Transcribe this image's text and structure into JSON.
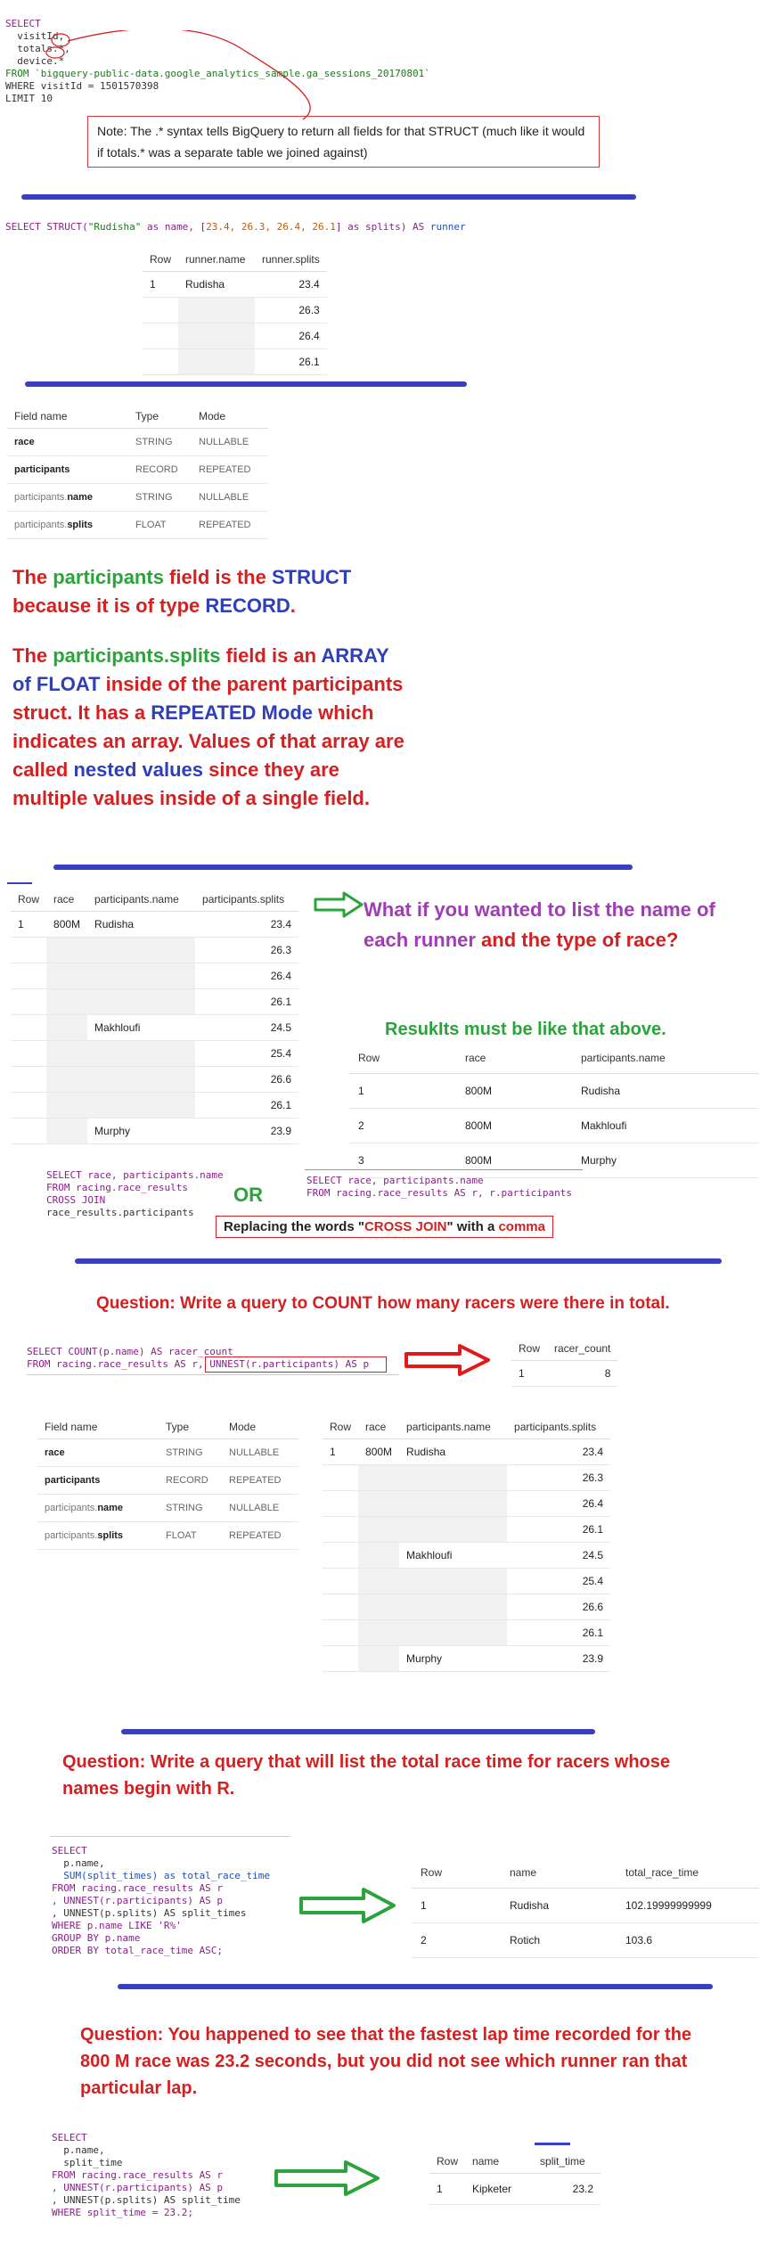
{
  "colors": {
    "red": "#d42020",
    "green": "#2aa43a",
    "blue": "#2e3fb8",
    "purple": "#a03cb4",
    "divider": "#3a3fc0"
  },
  "q1": {
    "lines": [
      "SELECT",
      "  visitId,",
      "  totals.*,",
      "  device.*",
      "FROM `bigquery-public-data.google_analytics_sample.ga_sessions_20170801`",
      "WHERE visitId = 1501570398",
      "LIMIT 10"
    ],
    "note": "Note: The .* syntax tells BigQuery to return all fields for that STRUCT (much like it would if totals.* was a separate table we joined against)"
  },
  "q2": {
    "sql": "SELECT STRUCT(\"Rudisha\" as name, [23.4, 26.3, 26.4, 26.1] as splits) AS runner",
    "table": {
      "headers": [
        "Row",
        "runner.name",
        "runner.splits"
      ],
      "row": "1",
      "name": "Rudisha",
      "splits": [
        "23.4",
        "26.3",
        "26.4",
        "26.1"
      ]
    }
  },
  "schema": {
    "headers": [
      "Field name",
      "Type",
      "Mode"
    ],
    "rows": [
      {
        "prefix": "",
        "name": "race",
        "type": "STRING",
        "mode": "NULLABLE"
      },
      {
        "prefix": "",
        "name": "participants",
        "type": "RECORD",
        "mode": "REPEATED"
      },
      {
        "prefix": "participants.",
        "name": "name",
        "type": "STRING",
        "mode": "NULLABLE"
      },
      {
        "prefix": "participants.",
        "name": "splits",
        "type": "FLOAT",
        "mode": "REPEATED"
      }
    ]
  },
  "explain": {
    "p1": [
      "The ",
      "participants",
      " field is the ",
      "STRUCT",
      " because it is of type ",
      "RECORD",
      "."
    ],
    "p2": [
      "The ",
      "participants.splits",
      " field is an ",
      "ARRAY of FLOAT",
      " inside of the parent participants struct. It has a ",
      "REPEATED Mode",
      " which indicates an array. Values of that array are called ",
      "nested values",
      " since they are multiple values inside of a single field."
    ]
  },
  "race_table": {
    "headers": [
      "Row",
      "race",
      "participants.name",
      "participants.splits"
    ],
    "row": "1",
    "race": "800M",
    "runners": [
      {
        "name": "Rudisha",
        "splits": [
          "23.4",
          "26.3",
          "26.4",
          "26.1"
        ]
      },
      {
        "name": "Makhloufi",
        "splits": [
          "24.5",
          "25.4",
          "26.6",
          "26.1"
        ]
      },
      {
        "name": "Murphy",
        "splits": [
          "23.9"
        ]
      }
    ]
  },
  "question_list": {
    "text_a": "What if you wanted to list the name of each runner",
    "text_b": " and the type of race?",
    "results_caption": "ResukIts must be like that above.",
    "table": {
      "headers": [
        "Row",
        "race",
        "participants.name"
      ],
      "rows": [
        [
          "1",
          "800M",
          "Rudisha"
        ],
        [
          "2",
          "800M",
          "Makhloufi"
        ],
        [
          "3",
          "800M",
          "Murphy"
        ]
      ]
    }
  },
  "cross_join": {
    "left": [
      "SELECT race, participants.name",
      "FROM racing.race_results",
      "CROSS JOIN",
      "race_results.participants"
    ],
    "or": "OR",
    "right": [
      "SELECT race, participants.name",
      "FROM racing.race_results AS r, r.participants"
    ],
    "caption_a": "Replacing the words \"",
    "caption_b": "CROSS JOIN",
    "caption_c": "\" with a ",
    "caption_d": "comma"
  },
  "count_q": {
    "question": "Question:  Write a query to COUNT how many racers were there in total.",
    "sql": [
      "SELECT COUNT(p.name) AS racer_count",
      "FROM racing.race_results AS r, UNNEST(r.participants) AS p"
    ],
    "result": {
      "headers": [
        "Row",
        "racer_count"
      ],
      "row": "1",
      "value": "8"
    }
  },
  "total_time_q": {
    "question": "Question: Write a query that will list the total race time for racers whose names begin with R.",
    "sql": [
      "SELECT",
      "  p.name,",
      "  SUM(split_times) as total_race_time",
      "FROM racing.race_results AS r",
      ", UNNEST(r.participants) AS p",
      ", UNNEST(p.splits) AS split_times",
      "WHERE p.name LIKE 'R%'",
      "GROUP BY p.name",
      "ORDER BY total_race_time ASC;"
    ],
    "result": {
      "headers": [
        "Row",
        "name",
        "total_race_time"
      ],
      "rows": [
        [
          "1",
          "Rudisha",
          "102.19999999999"
        ],
        [
          "2",
          "Rotich",
          "103.6"
        ]
      ]
    }
  },
  "fastest_q": {
    "question": "Question: You happened to see that the fastest lap time recorded for the 800 M race was 23.2 seconds, but you did not see which runner ran that particular lap.",
    "sql": [
      "SELECT",
      "  p.name,",
      "  split_time",
      "FROM racing.race_results AS r",
      ", UNNEST(r.participants) AS p",
      ", UNNEST(p.splits) AS split_time",
      "WHERE split_time = 23.2;"
    ],
    "result": {
      "headers": [
        "Row",
        "name",
        "split_time"
      ],
      "row": "1",
      "name": "Kipketer",
      "value": "23.2"
    }
  }
}
